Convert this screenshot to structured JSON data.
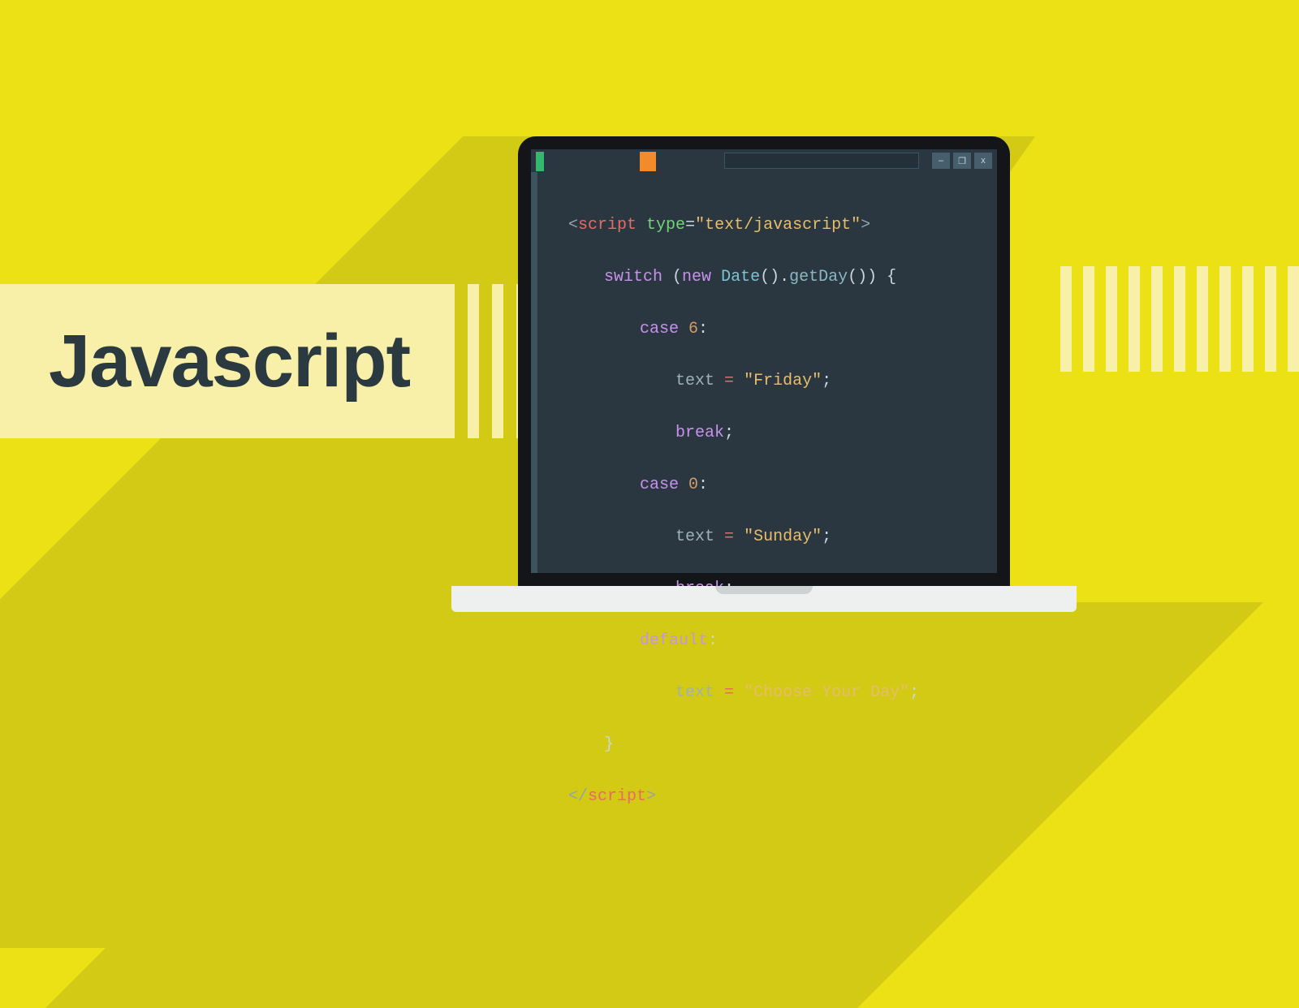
{
  "title": "Javascript",
  "window_controls": {
    "minimize": "–",
    "maximize": "❐",
    "close": "x"
  },
  "code": {
    "scriptOpen": {
      "angleOpen": "<",
      "tagName": "script",
      "attrName": "type",
      "eq": "=",
      "attrValue": "\"text/javascript\"",
      "angleClose": ">"
    },
    "line2": {
      "kwSwitch": "switch",
      "paren1": " (",
      "kwNew": "new",
      "sp": " ",
      "cls": "Date",
      "call1": "().",
      "fn": "getDay",
      "call2": "()) {"
    },
    "case6": {
      "kwCase": "case",
      "sp": " ",
      "num": "6",
      "colon": ":"
    },
    "assignFri": {
      "var": "text",
      "sp": " ",
      "op": "=",
      "str": "\"Friday\"",
      "semi": ";"
    },
    "break1": {
      "kw": "break",
      "semi": ";"
    },
    "case0": {
      "kwCase": "case",
      "sp": " ",
      "num": "0",
      "colon": ":"
    },
    "assignSun": {
      "var": "text",
      "sp": " ",
      "op": "=",
      "str": "\"Sunday\"",
      "semi": ";"
    },
    "break2": {
      "kw": "break",
      "semi": ";"
    },
    "default": {
      "kw": "default",
      "colon": ":"
    },
    "assignDefault": {
      "var": "text",
      "sp": " ",
      "op": "=",
      "str": "\"Choose Your Day\"",
      "semi": ";"
    },
    "closeBrace": {
      "txt": "}"
    },
    "scriptClose": {
      "angleOpen": "</",
      "tagName": "script",
      "angleClose": ">"
    }
  }
}
